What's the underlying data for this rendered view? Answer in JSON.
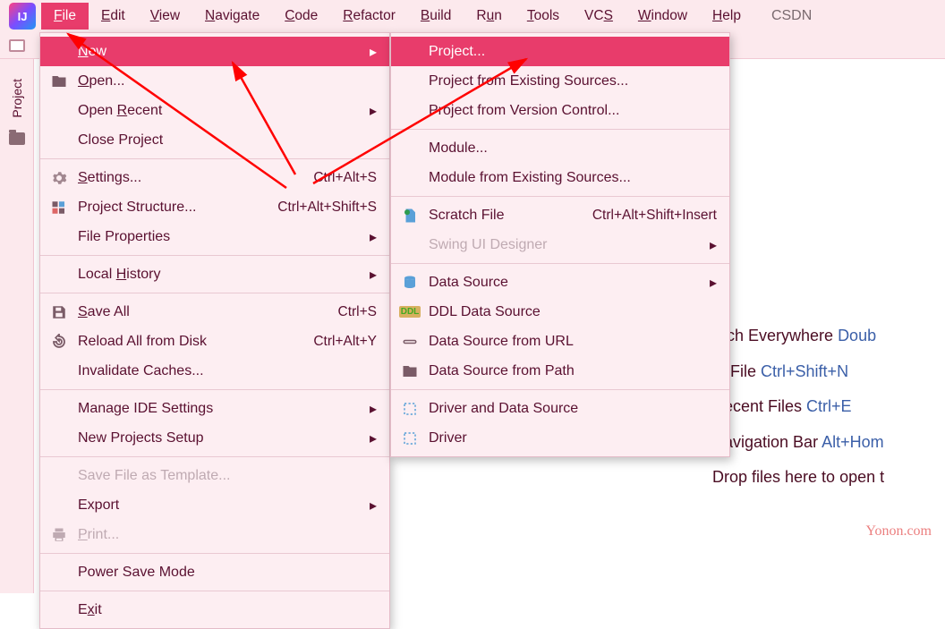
{
  "menubar": {
    "items": [
      {
        "label": "File",
        "hot": "F",
        "active": true
      },
      {
        "label": "Edit",
        "hot": "E"
      },
      {
        "label": "View",
        "hot": "V"
      },
      {
        "label": "Navigate",
        "hot": "N"
      },
      {
        "label": "Code",
        "hot": "C"
      },
      {
        "label": "Refactor",
        "hot": "R"
      },
      {
        "label": "Build",
        "hot": "B"
      },
      {
        "label": "Run",
        "hot": "u",
        "pos": 1
      },
      {
        "label": "Tools",
        "hot": "T"
      },
      {
        "label": "VCS",
        "hot": "S",
        "pos": 2
      },
      {
        "label": "Window",
        "hot": "W"
      },
      {
        "label": "Help",
        "hot": "H"
      }
    ],
    "extra": "CSDN"
  },
  "sidebar": {
    "label": "Project"
  },
  "file_menu": [
    {
      "icon": "",
      "label": "New",
      "hot": "N",
      "highlight": true,
      "arrow": true
    },
    {
      "icon": "open",
      "label": "Open...",
      "hot": "O"
    },
    {
      "icon": "",
      "label": "Open Recent",
      "hot": "R",
      "arrow": true
    },
    {
      "icon": "",
      "label": "Close Project"
    },
    {
      "sep": true
    },
    {
      "icon": "gear",
      "label": "Settings...",
      "hot": "S",
      "shortcut": "Ctrl+Alt+S"
    },
    {
      "icon": "struct",
      "label": "Project Structure...",
      "hot": "",
      "shortcut": "Ctrl+Alt+Shift+S"
    },
    {
      "icon": "",
      "label": "File Properties",
      "arrow": true
    },
    {
      "sep": true
    },
    {
      "icon": "",
      "label": "Local History",
      "hot": "H",
      "arrow": true
    },
    {
      "sep": true
    },
    {
      "icon": "save",
      "label": "Save All",
      "hot": "S",
      "shortcut": "Ctrl+S"
    },
    {
      "icon": "reload",
      "label": "Reload All from Disk",
      "shortcut": "Ctrl+Alt+Y"
    },
    {
      "icon": "",
      "label": "Invalidate Caches..."
    },
    {
      "sep": true
    },
    {
      "icon": "",
      "label": "Manage IDE Settings",
      "arrow": true
    },
    {
      "icon": "",
      "label": "New Projects Setup",
      "arrow": true
    },
    {
      "sep": true
    },
    {
      "icon": "",
      "label": "Save File as Template...",
      "disabled": true
    },
    {
      "icon": "",
      "label": "Export",
      "arrow": true
    },
    {
      "icon": "print",
      "label": "Print...",
      "hot": "P",
      "disabled": true
    },
    {
      "sep": true
    },
    {
      "icon": "",
      "label": "Power Save Mode"
    },
    {
      "sep": true
    },
    {
      "icon": "",
      "label": "Exit",
      "hot": "x"
    }
  ],
  "new_menu": [
    {
      "icon": "",
      "label": "Project...",
      "highlight": true
    },
    {
      "icon": "",
      "label": "Project from Existing Sources..."
    },
    {
      "icon": "",
      "label": "Project from Version Control..."
    },
    {
      "sep": true
    },
    {
      "icon": "",
      "label": "Module..."
    },
    {
      "icon": "",
      "label": "Module from Existing Sources..."
    },
    {
      "sep": true
    },
    {
      "icon": "scratch",
      "label": "Scratch File",
      "shortcut": "Ctrl+Alt+Shift+Insert"
    },
    {
      "icon": "",
      "label": "Swing UI Designer",
      "arrow": true,
      "disabled": true
    },
    {
      "sep": true
    },
    {
      "icon": "db",
      "label": "Data Source",
      "arrow": true
    },
    {
      "icon": "ddl",
      "label": "DDL Data Source"
    },
    {
      "icon": "url",
      "label": "Data Source from URL"
    },
    {
      "icon": "folder",
      "label": "Data Source from Path"
    },
    {
      "sep": true
    },
    {
      "icon": "driver",
      "label": "Driver and Data Source"
    },
    {
      "icon": "driver",
      "label": "Driver"
    }
  ],
  "hints": [
    {
      "t": "arch Everywhere ",
      "s": "Doub"
    },
    {
      "t": " to File ",
      "s": "Ctrl+Shift+N"
    },
    {
      "t": "Recent Files ",
      "s": "Ctrl+E"
    },
    {
      "t": "Navigation Bar ",
      "s": "Alt+Hom"
    },
    {
      "t": "Drop files here to open t",
      "s": ""
    }
  ],
  "watermark": "Yonon.com"
}
